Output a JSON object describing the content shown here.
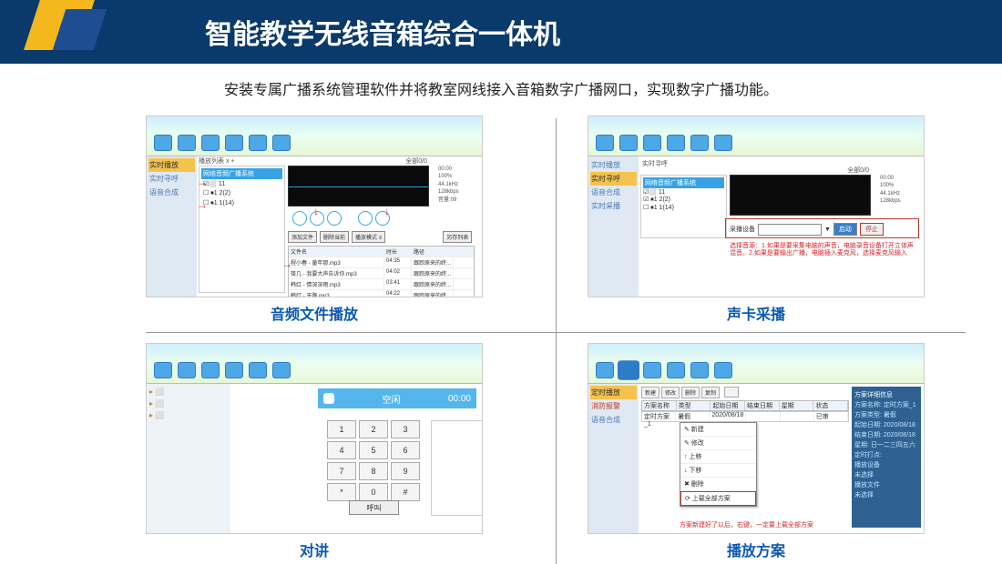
{
  "header": {
    "title": "智能教学无线音箱综合一体机"
  },
  "description": "安装专属广播系统管理软件并将教室网线接入音箱数字广播网口，实现数字广播功能。",
  "s1": {
    "caption": "音频文件播放",
    "nav": [
      "实时播放",
      "实时寻呼",
      "语音合成"
    ],
    "toolbar": "播放列表 x  +",
    "tree_header": "网络音频广播系统",
    "tree_items": [
      "☑⬜ 11",
      "☐ ⏹1 2(2)",
      "☐ ⏹1 1(14)"
    ],
    "all_sel": "全部0/0",
    "meters": [
      "00:00",
      "100%",
      "44.1kHz",
      "128kbps",
      "音量:09"
    ],
    "row2": [
      "添加文件",
      "删除当前",
      "播放模式 ≡",
      "另存列表"
    ],
    "table": [
      [
        "程小春 - 童年那.mp3",
        "04:35",
        "跟踪原来的终..."
      ],
      [
        "筷几 - 我要大声告诉你.mp3",
        "04:02",
        "跟踪原来的终..."
      ],
      [
        "韩红 - 情深深雨.mp3",
        "03:41",
        "跟踪原来的终..."
      ],
      [
        "韩红 - 天路.mp3",
        "04:22",
        "跟踪原来的终..."
      ]
    ],
    "col_h": [
      "文件名",
      "时长",
      "路径"
    ]
  },
  "s2": {
    "caption": "声卡采播",
    "nav": [
      "实时播放",
      "实时寻呼",
      "语音合成",
      "实时采播"
    ],
    "toolbar": "实时寻呼",
    "tree_header": "网络音频广播系统",
    "tree_items": [
      "☑⬜ 11",
      "☑ ⏹1 2(2)",
      "☐ ⏹1 1(14)"
    ],
    "all_sel": "全部0/0",
    "meters": [
      "00:00",
      "100%",
      "44.1kHz",
      "128kbps"
    ],
    "device_label": "采播设备",
    "btn_start": "启动",
    "btn_stop": "停止",
    "note": "选择音源：1.如果是要采集电脑的声音，电脑录音设备打开立体声混音。2.如果是要输出广播，电脑插入麦克风，选择麦克风输入"
  },
  "s3": {
    "caption": "对讲",
    "bar_label": "空闲",
    "timer": "00:00",
    "keys": [
      "1",
      "2",
      "3",
      "4",
      "5",
      "6",
      "7",
      "8",
      "9",
      "*",
      "0",
      "#"
    ],
    "call": "呼叫"
  },
  "s4": {
    "caption": "播放方案",
    "nav": [
      "定时播放",
      "消防报警",
      "语音合成"
    ],
    "tool": [
      "新建",
      "修改",
      "删除",
      "复制"
    ],
    "th": [
      "方案名称",
      "类型",
      "起始日期",
      "结束日期",
      "星期",
      "状态"
    ],
    "row": [
      "暑假",
      "2020/08/18",
      "",
      "",
      "已审"
    ],
    "menu": [
      "新建",
      "修改",
      "上移",
      "下移",
      "删除",
      "上载全部方案"
    ],
    "warn": "方案新建好了以后，右键，一定要上载全部方案",
    "side_title": "方案详细信息",
    "side": [
      "方案名称: 定时方案_1",
      "方案类型: 暑假",
      "起始日期: 2020/08/18",
      "结束日期: 2020/08/18",
      "星期: 日一二三四五六",
      "定时打点:",
      "播放设备",
      "未选择",
      "播放文件",
      "未选择"
    ]
  }
}
